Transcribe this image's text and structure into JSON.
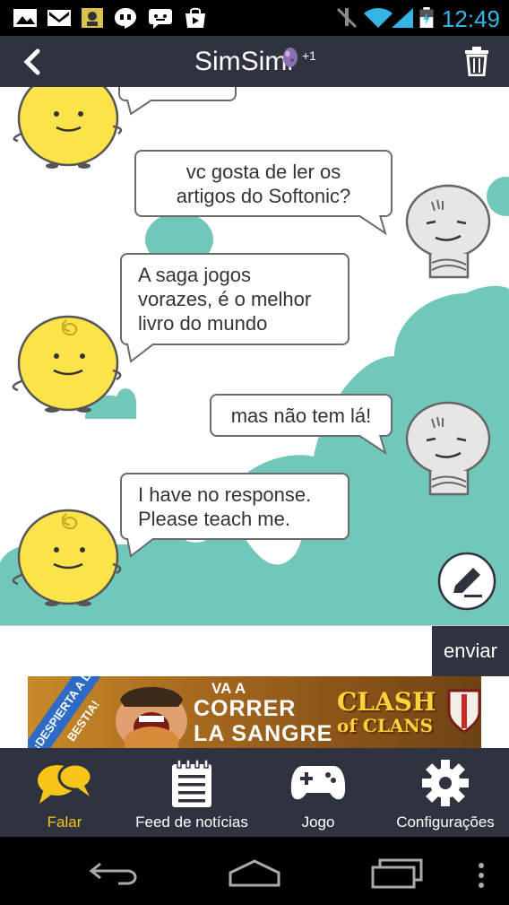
{
  "status_bar": {
    "time": "12:49",
    "icons": [
      "image-icon",
      "gmail-icon",
      "sticker-icon",
      "hangouts-icon",
      "chat-icon",
      "store-icon",
      "mute-icon",
      "wifi-icon",
      "signal-icon",
      "battery-icon"
    ]
  },
  "header": {
    "title": "SimSimi",
    "badge": "+1",
    "icons": [
      "back-icon",
      "egg-icon",
      "trash-icon"
    ]
  },
  "chat": {
    "messages": [
      {
        "from": "user",
        "text_lines": [
          "vc gosta de ler os",
          "artigos do Softonic?"
        ]
      },
      {
        "from": "bot",
        "text_lines": [
          "A saga jogos",
          "vorazes, é o melhor",
          "livro do mundo"
        ]
      },
      {
        "from": "user",
        "text_lines": [
          "mas não tem lá!"
        ]
      },
      {
        "from": "bot",
        "text_lines": [
          "I have no response.",
          "Please teach me."
        ]
      }
    ],
    "colors": {
      "cloud": "#72c7bb",
      "bot": "#fde34a",
      "user": "#e3e3e3"
    }
  },
  "input": {
    "value": "",
    "placeholder": "",
    "send_label": "enviar"
  },
  "ad": {
    "ribbon": "¡DESPIERTA A LA BESTIA!",
    "line_small": "VA A",
    "line1": "CORRER",
    "line2": "LA SANGRE",
    "brand_line1": "CLASH",
    "brand_line2": "of CLANS"
  },
  "tabs": [
    {
      "label": "Falar",
      "icon": "chat-bubbles-icon",
      "active": true
    },
    {
      "label": "Feed de notícias",
      "icon": "notepad-icon",
      "active": false
    },
    {
      "label": "Jogo",
      "icon": "gamepad-icon",
      "active": false
    },
    {
      "label": "Configurações",
      "icon": "gear-icon",
      "active": false
    }
  ],
  "nav": {
    "icons": [
      "back-nav-icon",
      "home-nav-icon",
      "recents-nav-icon",
      "overflow-menu-icon"
    ]
  },
  "accent": "#f5c518"
}
